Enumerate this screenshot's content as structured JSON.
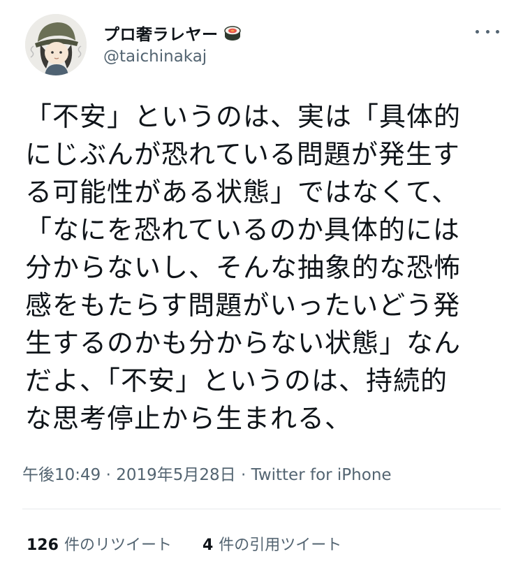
{
  "user": {
    "display_name": "プロ奢ラレヤー",
    "name_emoji": "sushi-emoji",
    "handle": "@taichinakaj"
  },
  "tweet": {
    "lines": [
      "「不安」というのは、実は「具体的",
      "にじぶんが恐れている問題が発生す",
      "る可能性がある状態」ではなくて、",
      "「なにを恐れているのか具体的には",
      "分からないし、そんな抽象的な恐怖",
      "感をもたらす問題がいったいどう発",
      "生するのかも分からない状態」なん",
      "だよ、「不安」というのは、持続的",
      "な思考停止から生まれる、"
    ]
  },
  "meta": {
    "timestamp": "午後10:49 · 2019年5月28日 · Twitter for iPhone"
  },
  "stats": {
    "retweets_count": "126",
    "retweets_label": "件のリツイート",
    "quotes_count": "4",
    "quotes_label": "件の引用ツイート"
  },
  "colors": {
    "text": "#0f1419",
    "secondary": "#536471",
    "divider": "#e6e9eb"
  }
}
